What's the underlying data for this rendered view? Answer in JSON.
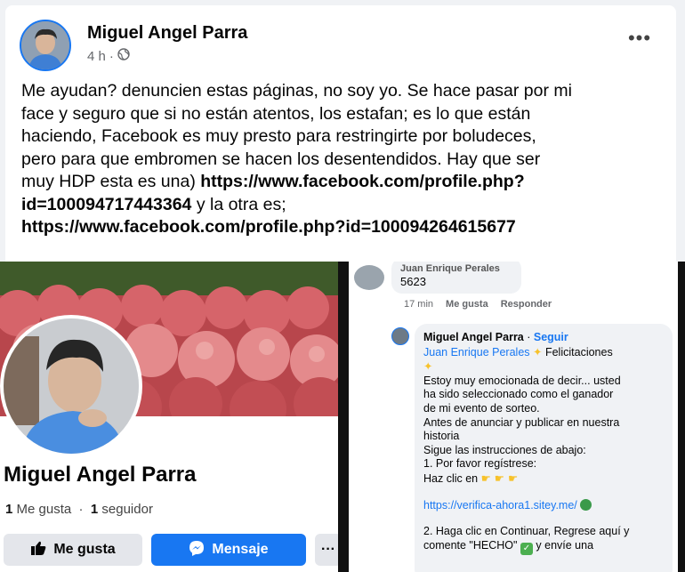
{
  "post": {
    "author": "Miguel Angel Parra",
    "time": "4 h",
    "separator": "·",
    "more_label": "•••",
    "text_lines": [
      "Me ayudan? denuncien estas páginas, no soy yo. Se hace pasar por mi",
      "face y seguro que si no están atentos, los estafan; es lo que están",
      "haciendo, Facebook es muy presto para restringirte por boludeces,",
      "pero para que embromen se hacen los desentendidos. Hay que ser"
    ],
    "line5_prefix": "muy HDP  esta es una) ",
    "link1_part1": "https://www.facebook.com/profile.php?",
    "link1_part2": "id=100094717443364",
    "line6_suffix": " y la otra es;",
    "link2": "https://www.facebook.com/profile.php?id=100094264615677"
  },
  "profile": {
    "name": "Miguel Angel Parra",
    "likes_count": "1",
    "likes_label": " Me gusta",
    "dot": "  ·  ",
    "followers_count": "1",
    "followers_label": " seguidor",
    "like_button": "Me gusta",
    "message_button": "Mensaje",
    "more_button": "···"
  },
  "comments": {
    "first": {
      "name": "Juan Enrique Perales",
      "text": "5623",
      "time": "17 min",
      "like": "Me gusta",
      "reply": "Responder"
    },
    "second": {
      "name": "Miguel Angel Parra",
      "sep": " · ",
      "follow": "Seguir",
      "mention": "Juan Enrique Perales",
      "greeting": " Felicitaciones",
      "line1": "Estoy muy emocionada de decir... usted",
      "line2": "ha sido seleccionado como el ganador",
      "line3": "de mi evento de sorteo.",
      "line4": "Antes de anunciar y publicar en nuestra",
      "line5": "historia",
      "line6": "Sigue las instrucciones de abajo:",
      "line7": "1. Por favor regístrese:",
      "line8": "Haz clic en",
      "url": "https://verifica-ahora1.sitey.me/",
      "line9": "2. Haga clic en Continuar, Regrese aquí y",
      "line10_a": "comente \"HECHO\"",
      "line10_b": " y envíe una"
    }
  },
  "icons": {
    "globe": "globe-icon",
    "thumbs_up": "thumbs-up-icon",
    "messenger": "messenger-icon"
  },
  "colors": {
    "brand": "#1877f2",
    "button_gray": "#e4e6eb",
    "bubble_gray": "#f0f2f5"
  }
}
